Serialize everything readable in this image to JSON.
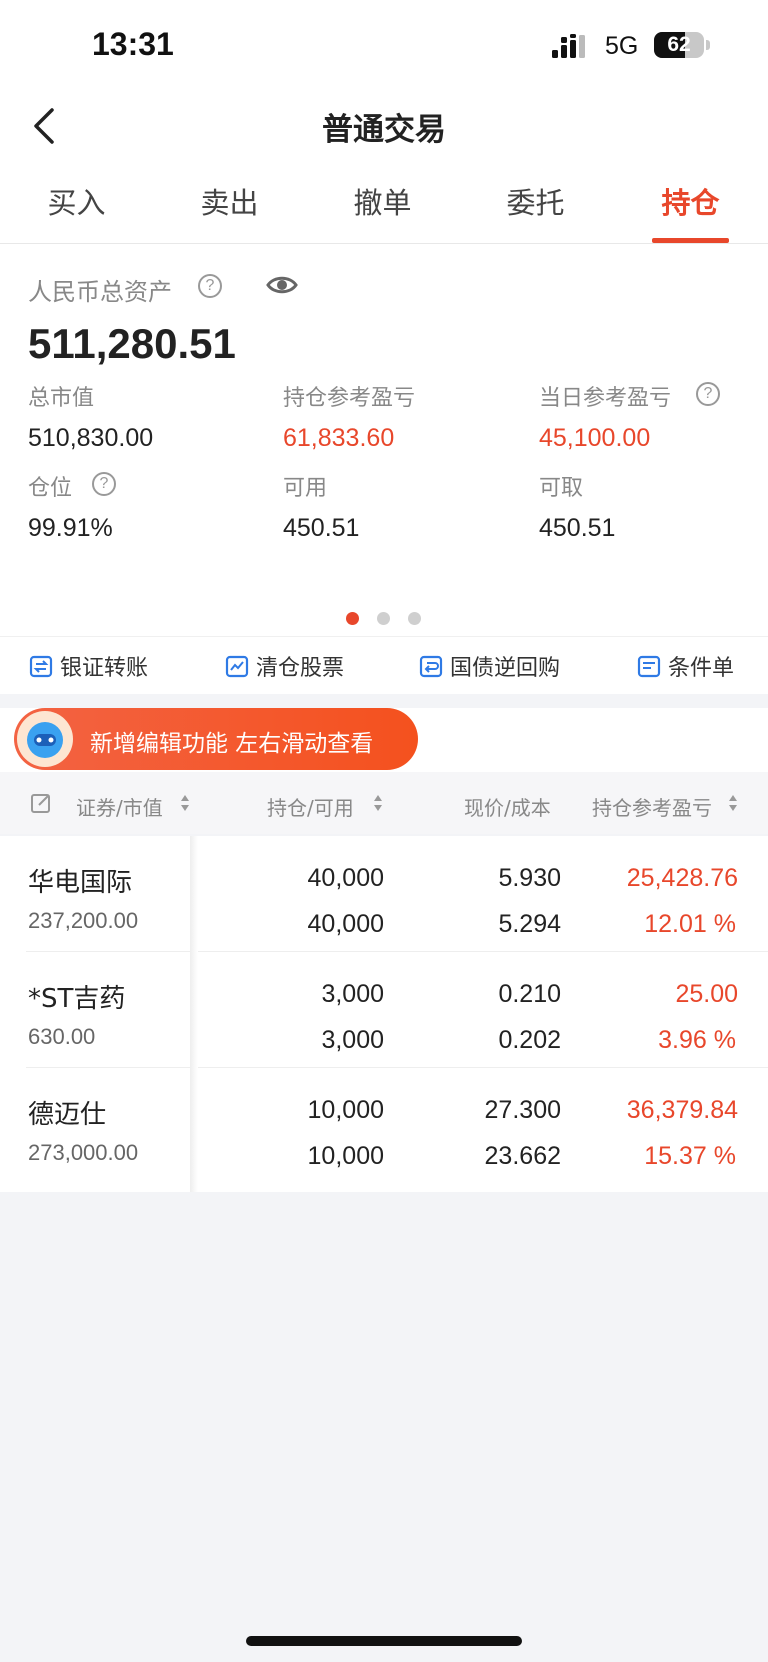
{
  "status_bar": {
    "time": "13:31",
    "network": "5G",
    "battery": "62",
    "battery_level": 0.62
  },
  "nav": {
    "title": "普通交易",
    "back_icon": "chevron-left-icon"
  },
  "tabs": [
    {
      "label": "买入"
    },
    {
      "label": "卖出"
    },
    {
      "label": "撤单"
    },
    {
      "label": "委托"
    },
    {
      "label": "持仓"
    }
  ],
  "active_tab": "持仓",
  "assets": {
    "total_label": "人民币总资产",
    "total_value": "511,280.51",
    "metrics": {
      "market_value": {
        "label": "总市值",
        "value": "510,830.00"
      },
      "position_pl": {
        "label": "持仓参考盈亏",
        "value": "61,833.60"
      },
      "daily_pl": {
        "label": "当日参考盈亏",
        "value": "45,100.00"
      },
      "position_ratio": {
        "label": "仓位",
        "value": "99.91%"
      },
      "available": {
        "label": "可用",
        "value": "450.51"
      },
      "withdrawable": {
        "label": "可取",
        "value": "450.51"
      }
    },
    "page_indicator": {
      "count": 3,
      "active": 1
    }
  },
  "quick_links": [
    {
      "label": "银证转账",
      "icon": "bank-transfer-icon"
    },
    {
      "label": "清仓股票",
      "icon": "clear-stock-icon"
    },
    {
      "label": "国债逆回购",
      "icon": "repo-icon"
    },
    {
      "label": "条件单",
      "icon": "conditional-order-icon"
    }
  ],
  "promo": {
    "text": "新增编辑功能 左右滑动查看"
  },
  "table": {
    "headers": {
      "security": "证券/市值",
      "position": "持仓/可用",
      "price": "现价/成本",
      "pl": "持仓参考盈亏"
    },
    "rows": [
      {
        "name": "华电国际",
        "market_value": "237,200.00",
        "holding": "40,000",
        "available": "40,000",
        "price": "5.930",
        "cost": "5.294",
        "pl": "25,428.76",
        "pl_pct": "12.01 %"
      },
      {
        "name": "*ST吉药",
        "market_value": "630.00",
        "holding": "3,000",
        "available": "3,000",
        "price": "0.210",
        "cost": "0.202",
        "pl": "25.00",
        "pl_pct": "3.96 %"
      },
      {
        "name": "德迈仕",
        "market_value": "273,000.00",
        "holding": "10,000",
        "available": "10,000",
        "price": "27.300",
        "cost": "23.662",
        "pl": "36,379.84",
        "pl_pct": "15.37 %"
      }
    ]
  },
  "colors": {
    "accent": "#e8472b",
    "background": "#f3f4f7"
  }
}
